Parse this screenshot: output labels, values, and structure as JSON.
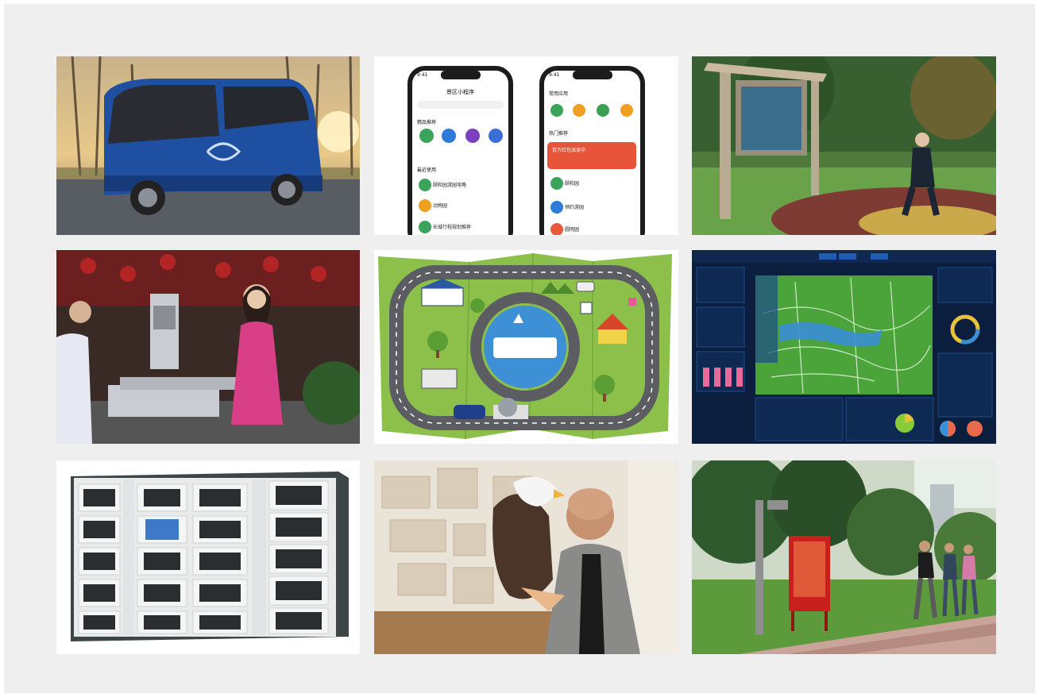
{
  "collage": {
    "tiles": [
      {
        "id": "autonomous-minibus"
      },
      {
        "id": "mini-program-phones"
      },
      {
        "id": "outdoor-display-fitness"
      },
      {
        "id": "face-recognition-gate"
      },
      {
        "id": "park-cartoon-map"
      },
      {
        "id": "dashboard-map"
      },
      {
        "id": "smart-locker"
      },
      {
        "id": "man-with-eagle"
      },
      {
        "id": "park-running-path"
      }
    ]
  },
  "phone_left": {
    "time": "9:41",
    "title": "景区小程序",
    "section_1": "精品推荐",
    "section_2": "最近使用",
    "item_1": "颐和园游园攻略",
    "item_2": "动物园",
    "item_3": "长城行程规划推荐"
  },
  "phone_right": {
    "time": "9:41",
    "section_1": "常用应用",
    "section_2": "热门推荐",
    "banner": "百万红包派发中",
    "item_1": "颐和园",
    "item_2": "预约游园",
    "item_3": "圆明园"
  },
  "colors": {
    "background": "#efefef",
    "bus_blue": "#1f4fa0",
    "jacket_pink": "#d93f86",
    "map_green": "#8cc04b",
    "dashboard_navy": "#0b1e3d",
    "sign_red": "#c8211d"
  }
}
